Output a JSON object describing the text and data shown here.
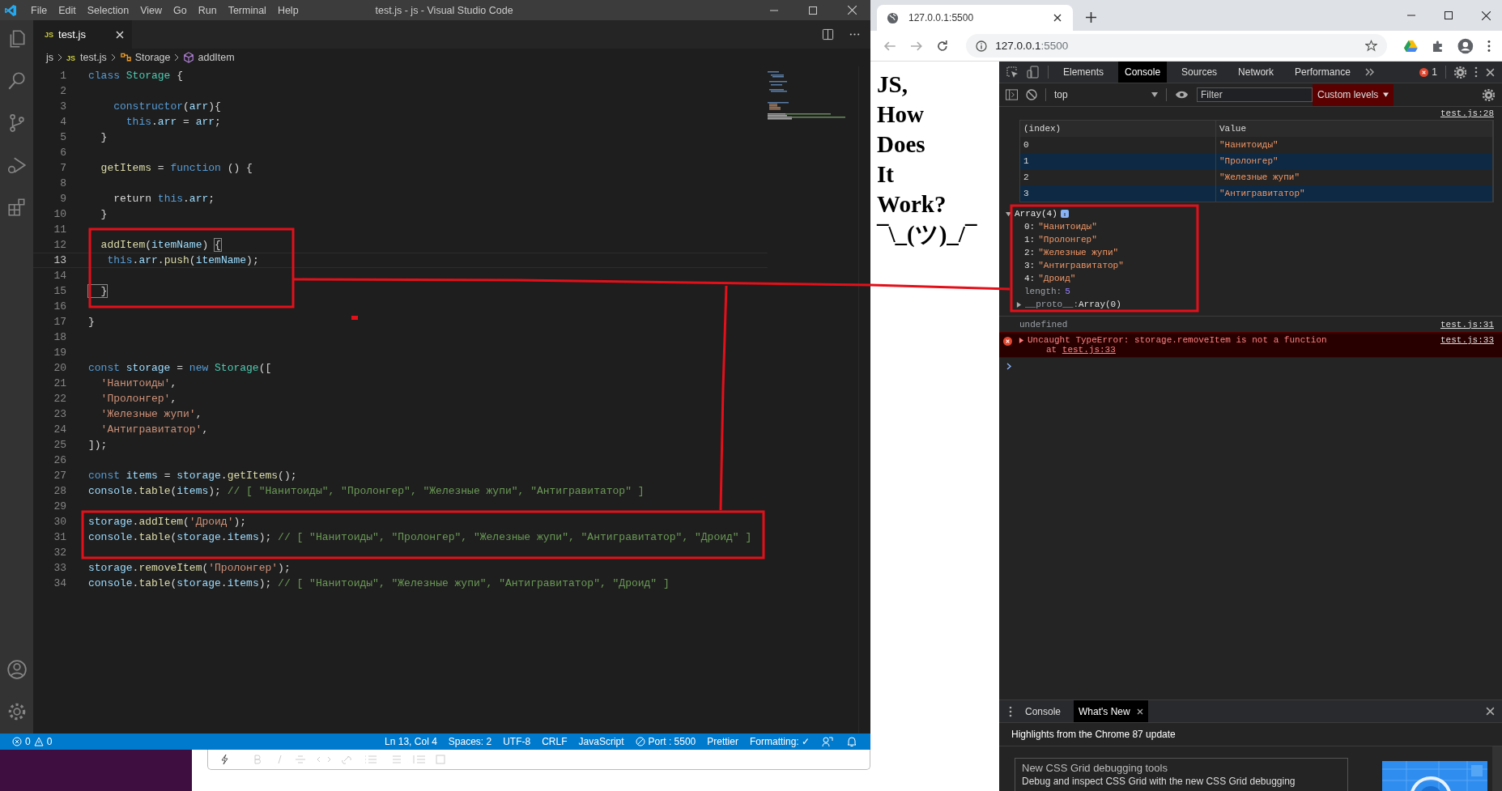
{
  "vscode": {
    "menu": [
      "File",
      "Edit",
      "Selection",
      "View",
      "Go",
      "Run",
      "Terminal",
      "Help"
    ],
    "title": "test.js - js - Visual Studio Code",
    "tab": {
      "badge": "JS",
      "label": "test.js"
    },
    "breadcrumb": [
      {
        "label": "js",
        "kind": "folder"
      },
      {
        "label": "test.js",
        "kind": "file",
        "badge": "JS"
      },
      {
        "label": "Storage",
        "kind": "class"
      },
      {
        "label": "addItem",
        "kind": "method"
      }
    ],
    "lines": [
      {
        "number": "1",
        "active": false,
        "tokens": [
          {
            "text": "class ",
            "kind": "k"
          },
          {
            "text": "Storage",
            "kind": "t"
          },
          {
            "text": " {",
            "kind": "p"
          }
        ]
      },
      {
        "number": "2",
        "active": false
      },
      {
        "number": "3",
        "active": false,
        "tokens": [
          {
            "text": "    constructor",
            "kind": "k"
          },
          {
            "text": "(",
            "kind": "p"
          },
          {
            "text": "arr",
            "kind": "v"
          },
          {
            "text": "){",
            "kind": "p"
          }
        ]
      },
      {
        "number": "4",
        "active": false,
        "tokens": [
          {
            "text": "      this",
            "kind": "k"
          },
          {
            "text": ".",
            "kind": "p"
          },
          {
            "text": "arr",
            "kind": "v"
          },
          {
            "text": " = ",
            "kind": "p"
          },
          {
            "text": "arr",
            "kind": "v"
          },
          {
            "text": ";",
            "kind": "p"
          }
        ]
      },
      {
        "number": "5",
        "active": false,
        "tokens": [
          {
            "text": "  }",
            "kind": "p"
          }
        ]
      },
      {
        "number": "6",
        "active": false
      },
      {
        "number": "7",
        "active": false,
        "tokens": [
          {
            "text": "  getItems",
            "kind": "f"
          },
          {
            "text": " = ",
            "kind": "p"
          },
          {
            "text": "function",
            "kind": "k"
          },
          {
            "text": " () {",
            "kind": "p"
          }
        ]
      },
      {
        "number": "8",
        "active": false
      },
      {
        "number": "9",
        "active": false,
        "tokens": [
          {
            "text": "    return ",
            "kind": "p"
          },
          {
            "text": "this",
            "kind": "k"
          },
          {
            "text": ".",
            "kind": "p"
          },
          {
            "text": "arr",
            "kind": "v"
          },
          {
            "text": ";",
            "kind": "p"
          }
        ]
      },
      {
        "number": "10",
        "active": false,
        "tokens": [
          {
            "text": "  }",
            "kind": "p"
          }
        ]
      },
      {
        "number": "11",
        "active": false
      },
      {
        "number": "12",
        "active": false,
        "tokens": [
          {
            "text": "  addItem",
            "kind": "f"
          },
          {
            "text": "(",
            "kind": "p"
          },
          {
            "text": "itemName",
            "kind": "v"
          },
          {
            "text": ") ",
            "kind": "p"
          },
          {
            "text": "{",
            "kind": "b"
          }
        ]
      },
      {
        "number": "13",
        "active": true,
        "tokens": [
          {
            "text": "   this",
            "kind": "k"
          },
          {
            "text": ".",
            "kind": "p"
          },
          {
            "text": "arr",
            "kind": "v"
          },
          {
            "text": ".",
            "kind": "p"
          },
          {
            "text": "push",
            "kind": "f"
          },
          {
            "text": "(",
            "kind": "p"
          },
          {
            "text": "itemName",
            "kind": "v"
          },
          {
            "text": ");",
            "kind": "p"
          }
        ]
      },
      {
        "number": "14",
        "active": false
      },
      {
        "number": "15",
        "active": false,
        "tokens": [
          {
            "text": "  }",
            "kind": "b"
          }
        ]
      },
      {
        "number": "16",
        "active": false
      },
      {
        "number": "17",
        "active": false,
        "tokens": [
          {
            "text": "}",
            "kind": "p"
          }
        ]
      },
      {
        "number": "18",
        "active": false
      },
      {
        "number": "19",
        "active": false
      },
      {
        "number": "20",
        "active": false,
        "tokens": [
          {
            "text": "const ",
            "kind": "k"
          },
          {
            "text": "storage",
            "kind": "v"
          },
          {
            "text": " = ",
            "kind": "p"
          },
          {
            "text": "new ",
            "kind": "k"
          },
          {
            "text": "Storage",
            "kind": "t"
          },
          {
            "text": "([",
            "kind": "p"
          }
        ]
      },
      {
        "number": "21",
        "active": false,
        "tokens": [
          {
            "text": "  'Нанитоиды'",
            "kind": "s"
          },
          {
            "text": ",",
            "kind": "p"
          }
        ]
      },
      {
        "number": "22",
        "active": false,
        "tokens": [
          {
            "text": "  'Пролонгер'",
            "kind": "s"
          },
          {
            "text": ",",
            "kind": "p"
          }
        ]
      },
      {
        "number": "23",
        "active": false,
        "tokens": [
          {
            "text": "  'Железные жупи'",
            "kind": "s"
          },
          {
            "text": ",",
            "kind": "p"
          }
        ]
      },
      {
        "number": "24",
        "active": false,
        "tokens": [
          {
            "text": "  'Антигравитатор'",
            "kind": "s"
          },
          {
            "text": ",",
            "kind": "p"
          }
        ]
      },
      {
        "number": "25",
        "active": false,
        "tokens": [
          {
            "text": "]);",
            "kind": "p"
          }
        ]
      },
      {
        "number": "26",
        "active": false
      },
      {
        "number": "27",
        "active": false,
        "tokens": [
          {
            "text": "const ",
            "kind": "k"
          },
          {
            "text": "items",
            "kind": "v"
          },
          {
            "text": " = ",
            "kind": "p"
          },
          {
            "text": "storage",
            "kind": "v"
          },
          {
            "text": ".",
            "kind": "p"
          },
          {
            "text": "getItems",
            "kind": "f"
          },
          {
            "text": "();",
            "kind": "p"
          }
        ]
      },
      {
        "number": "28",
        "active": false,
        "tokens": [
          {
            "text": "console",
            "kind": "v"
          },
          {
            "text": ".",
            "kind": "p"
          },
          {
            "text": "table",
            "kind": "f"
          },
          {
            "text": "(",
            "kind": "p"
          },
          {
            "text": "items",
            "kind": "v"
          },
          {
            "text": "); ",
            "kind": "p"
          },
          {
            "text": "// [ \"Нанитоиды\", \"Пролонгер\", \"Железные жупи\", \"Антигравитатор\" ]",
            "kind": "c"
          }
        ]
      },
      {
        "number": "29",
        "active": false
      },
      {
        "number": "30",
        "active": false,
        "tokens": [
          {
            "text": "storage",
            "kind": "v"
          },
          {
            "text": ".",
            "kind": "p"
          },
          {
            "text": "addItem",
            "kind": "f"
          },
          {
            "text": "(",
            "kind": "p"
          },
          {
            "text": "'Дроид'",
            "kind": "s"
          },
          {
            "text": ");",
            "kind": "p"
          }
        ]
      },
      {
        "number": "31",
        "active": false,
        "tokens": [
          {
            "text": "console",
            "kind": "v"
          },
          {
            "text": ".",
            "kind": "p"
          },
          {
            "text": "table",
            "kind": "f"
          },
          {
            "text": "(",
            "kind": "p"
          },
          {
            "text": "storage",
            "kind": "v"
          },
          {
            "text": ".",
            "kind": "p"
          },
          {
            "text": "items",
            "kind": "v"
          },
          {
            "text": "); ",
            "kind": "p"
          },
          {
            "text": "// [ \"Нанитоиды\", \"Пролонгер\", \"Железные жупи\", \"Антигравитатор\", \"Дроид\" ]",
            "kind": "c"
          }
        ]
      },
      {
        "number": "32",
        "active": false
      },
      {
        "number": "33",
        "active": false,
        "tokens": [
          {
            "text": "storage",
            "kind": "v"
          },
          {
            "text": ".",
            "kind": "p"
          },
          {
            "text": "removeItem",
            "kind": "f"
          },
          {
            "text": "(",
            "kind": "p"
          },
          {
            "text": "'Пролонгер'",
            "kind": "s"
          },
          {
            "text": ");",
            "kind": "p"
          }
        ]
      },
      {
        "number": "34",
        "active": false,
        "tokens": [
          {
            "text": "console",
            "kind": "v"
          },
          {
            "text": ".",
            "kind": "p"
          },
          {
            "text": "table",
            "kind": "f"
          },
          {
            "text": "(",
            "kind": "p"
          },
          {
            "text": "storage",
            "kind": "v"
          },
          {
            "text": ".",
            "kind": "p"
          },
          {
            "text": "items",
            "kind": "v"
          },
          {
            "text": "); ",
            "kind": "p"
          },
          {
            "text": "// [ \"Нанитоиды\", \"Железные жупи\", \"Антигравитатор\", \"Дроид\" ]",
            "kind": "c"
          }
        ]
      }
    ],
    "status_bar": {
      "errors": "0",
      "warnings": "0",
      "items": [
        {
          "label": "Ln 13, Col 4",
          "kind": "text"
        },
        {
          "label": "Spaces: 2",
          "kind": "text"
        },
        {
          "label": "UTF-8",
          "kind": "text"
        },
        {
          "label": "CRLF",
          "kind": "text"
        },
        {
          "label": "JavaScript",
          "kind": "text"
        },
        {
          "label": "Port : 5500",
          "kind": "port"
        },
        {
          "label": "Prettier",
          "kind": "text"
        },
        {
          "label": "Formatting: ✓",
          "kind": "text"
        }
      ]
    }
  },
  "browser": {
    "tab_title": "127.0.0.1:5500",
    "address": {
      "host": "127.0.0.1",
      "port": ":5500"
    },
    "page_heading": [
      "JS,",
      "How",
      "Does",
      "It",
      "Work?",
      "¯\\_(ツ)_/¯"
    ],
    "devtools": {
      "tabs": [
        {
          "label": "Elements",
          "selected": false
        },
        {
          "label": "Console",
          "selected": true
        },
        {
          "label": "Sources",
          "selected": false
        },
        {
          "label": "Network",
          "selected": false
        },
        {
          "label": "Performance",
          "selected": false
        }
      ],
      "error_count": "1",
      "context": "top",
      "filter": {
        "placeholder": "Filter"
      },
      "levels": "Custom levels",
      "console": [
        {
          "kind": "table",
          "source": "test.js:28",
          "columns": [
            "(index)",
            "Value"
          ],
          "rows": [
            [
              "0",
              "\"Нанитоиды\""
            ],
            [
              "1",
              "\"Пролонгер\""
            ],
            [
              "2",
              "\"Железные жупи\""
            ],
            [
              "3",
              "\"Антигравитатор\""
            ]
          ]
        },
        {
          "kind": "tree",
          "expanded": true,
          "label": "Array(4)",
          "entries": [
            {
              "key": "0:",
              "value": "\"Нанитоиды\"",
              "kind": "string"
            },
            {
              "key": "1:",
              "value": "\"Пролонгер\"",
              "kind": "string"
            },
            {
              "key": "2:",
              "value": "\"Железные жупи\"",
              "kind": "string"
            },
            {
              "key": "3:",
              "value": "\"Антигравитатор\"",
              "kind": "string"
            },
            {
              "key": "4:",
              "value": "\"Дроид\"",
              "kind": "string"
            },
            {
              "key": "length:",
              "value": "5",
              "kind": "number"
            }
          ],
          "proto": {
            "key": "__proto__:",
            "value": "Array(0)",
            "expanded": false
          }
        },
        {
          "kind": "value",
          "text": "undefined",
          "source": "test.js:31"
        },
        {
          "kind": "error",
          "expanded": false,
          "text": "Uncaught TypeError: storage.removeItem is not a function",
          "at": "at",
          "link": "test.js:33",
          "source": "test.js:33"
        }
      ],
      "drawer": {
        "tabs": [
          {
            "label": "Console",
            "selected": false,
            "closable": false
          },
          {
            "label": "What's New",
            "selected": true,
            "closable": true
          }
        ],
        "headline": "Highlights from the Chrome 87 update",
        "card": {
          "title": "New CSS Grid debugging tools",
          "text": "Debug and inspect CSS Grid with the new CSS Grid debugging"
        }
      }
    }
  }
}
